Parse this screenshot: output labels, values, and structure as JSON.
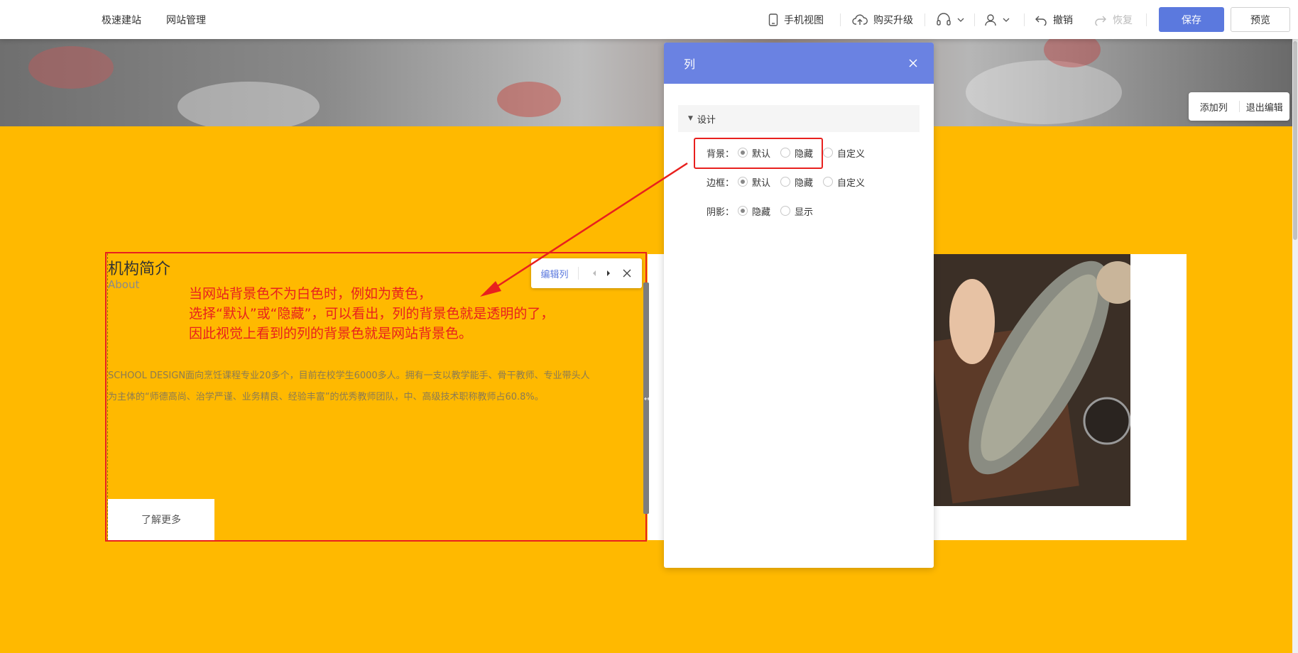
{
  "topbar": {
    "nav": [
      "极速建站",
      "网站管理"
    ],
    "mobile_view": "手机视图",
    "upgrade": "购买升级",
    "undo": "撤销",
    "redo": "恢复",
    "save": "保存",
    "preview": "预览"
  },
  "canvas": {
    "add_column": "添加列",
    "exit_edit": "退出编辑",
    "edit_column": "编辑列",
    "about_title": "机构简介",
    "about_subtitle": "About",
    "description": "SCHOOL DESIGN面向烹饪课程专业20多个，目前在校学生6000多人。拥有一支以教学能手、骨干教师、专业带头人为主体的“师德高尚、治学严谨、业务精良、经验丰富”的优秀教师团队，中、高级技术职称教师占60.8%。",
    "learn_more": "了解更多",
    "annotation": [
      "当网站背景色不为白色时，例如为黄色，",
      "选择“默认”或“隐藏”，可以看出，列的背景色就是透明的了，",
      "因此视觉上看到的列的背景色就是网站背景色。"
    ],
    "page_bg": "#ffb900"
  },
  "panel": {
    "title": "列",
    "section": "设计",
    "rows": [
      {
        "label": "背景：",
        "options": [
          "默认",
          "隐藏",
          "自定义"
        ],
        "selected": 0
      },
      {
        "label": "边框：",
        "options": [
          "默认",
          "隐藏",
          "自定义"
        ],
        "selected": 0
      },
      {
        "label": "阴影：",
        "options": [
          "隐藏",
          "显示"
        ],
        "selected": 0
      }
    ],
    "accent": "#6a82e2"
  },
  "colors": {
    "annotation": "#e8201e",
    "save_button": "#5b79de"
  }
}
